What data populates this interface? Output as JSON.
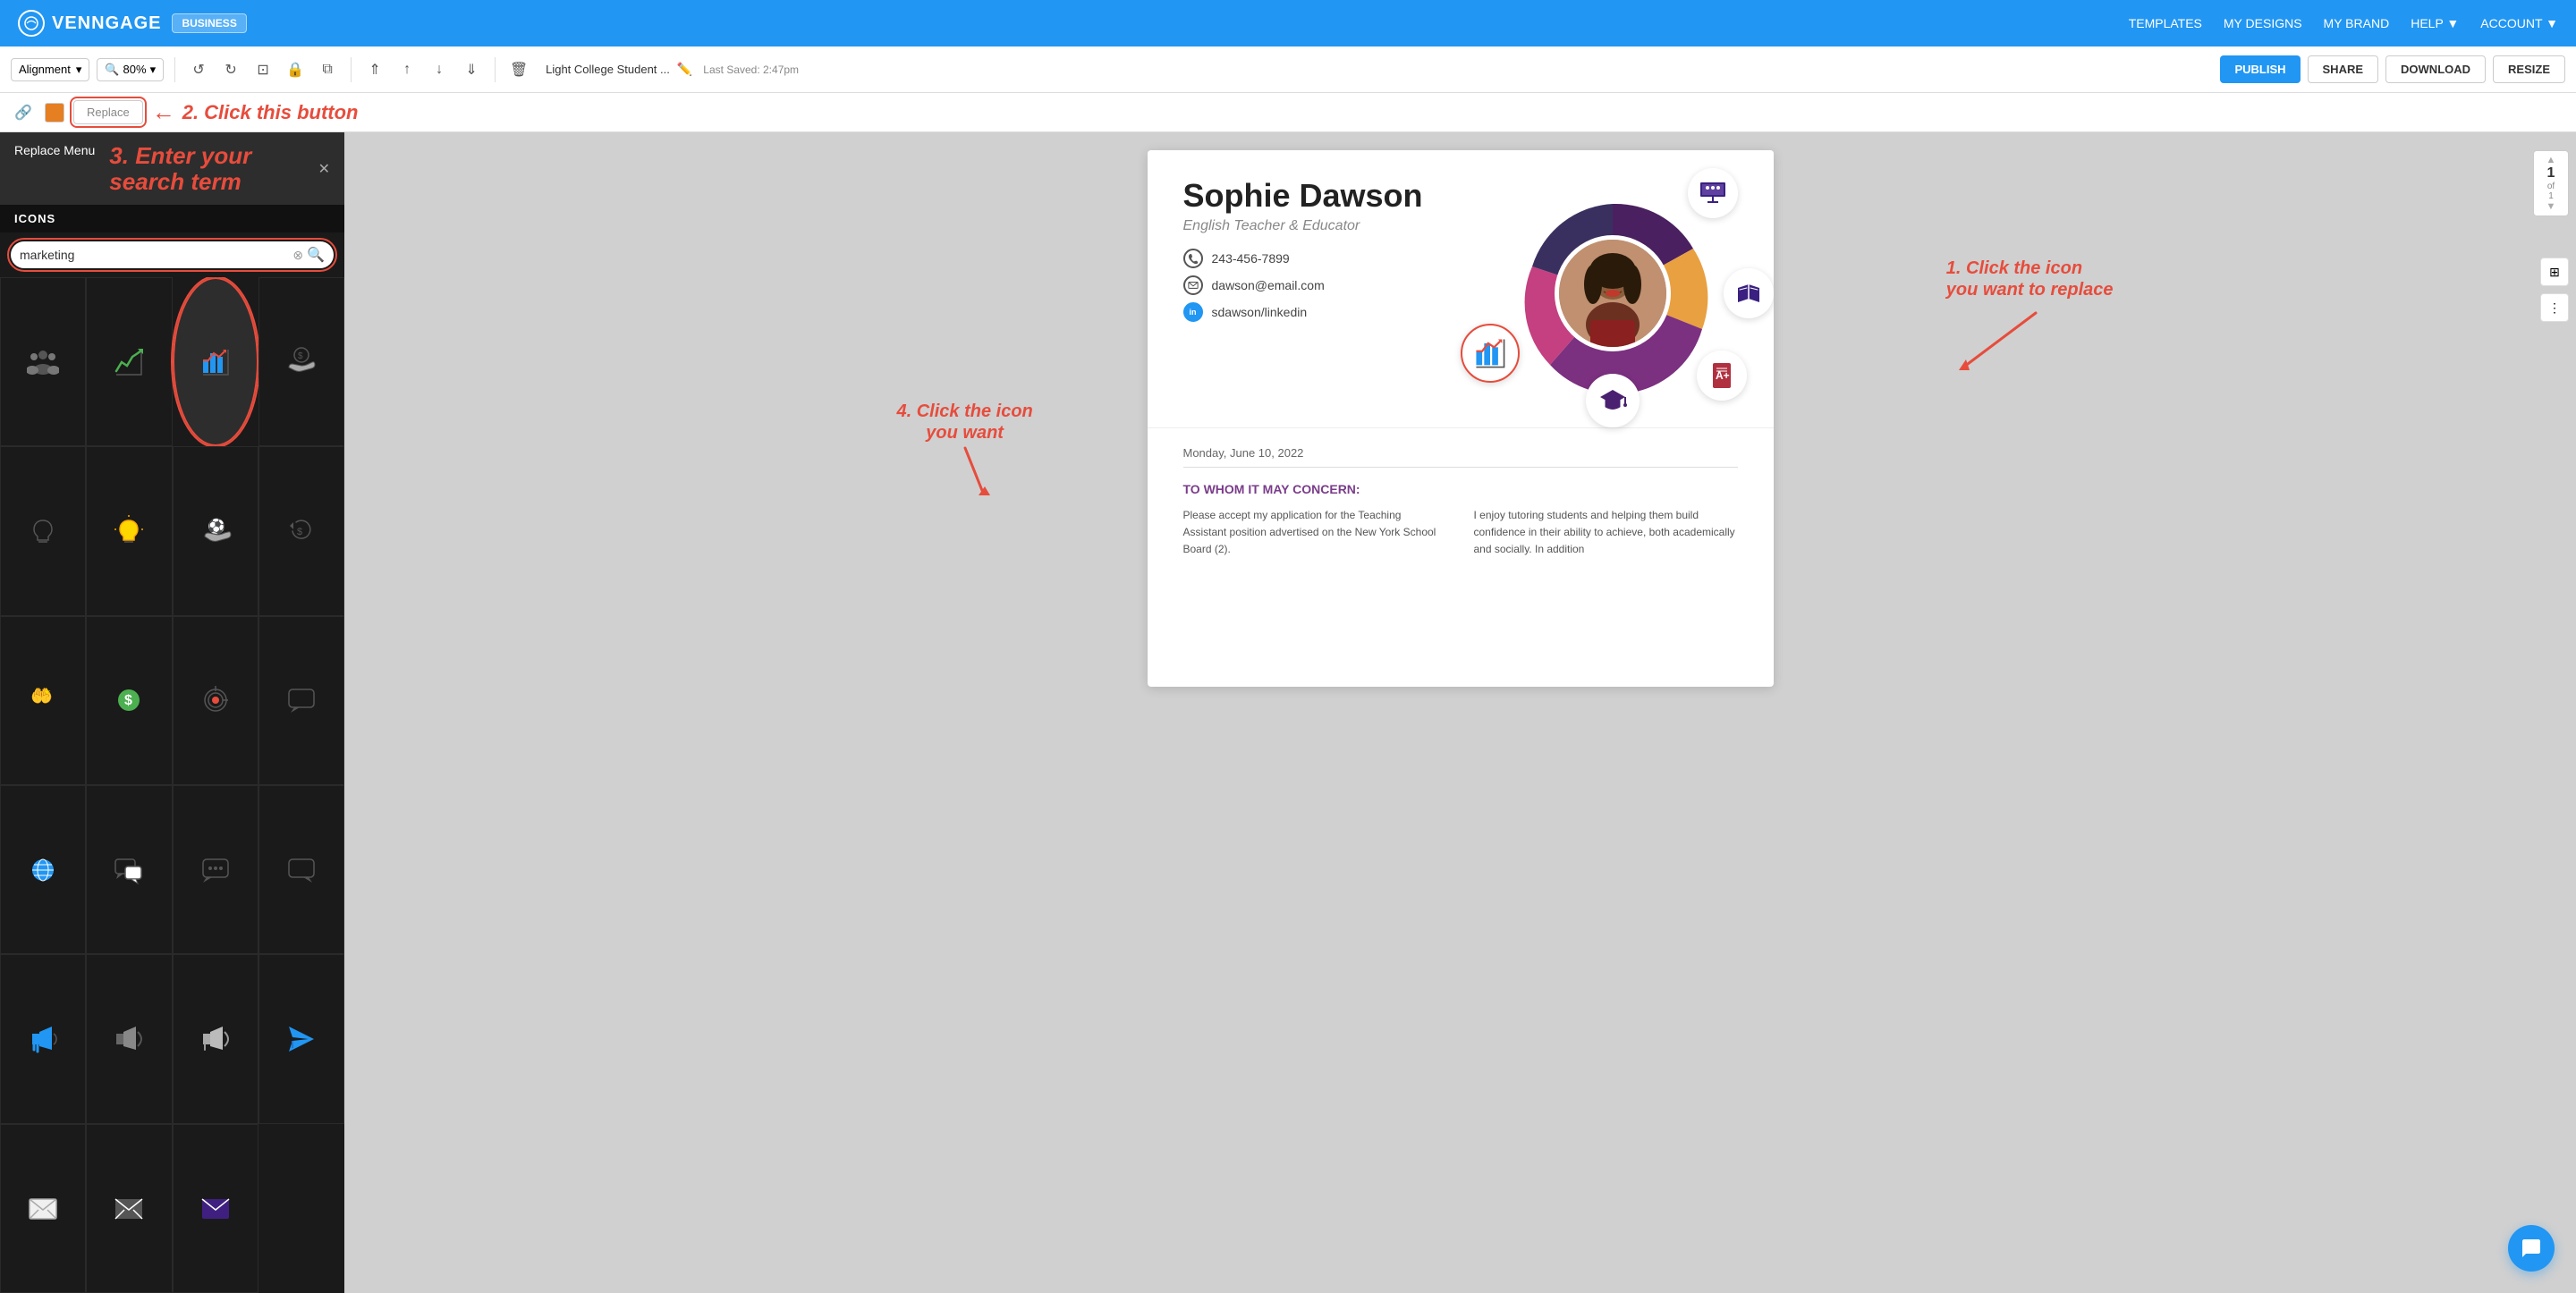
{
  "nav": {
    "logo": "VENNGAGE",
    "business_badge": "BUSINESS",
    "items": [
      "TEMPLATES",
      "MY DESIGNS",
      "MY BRAND",
      "HELP ▼",
      "ACCOUNT ▼"
    ]
  },
  "toolbar": {
    "alignment_label": "Alignment",
    "zoom_label": "80%",
    "title": "Light College Student ...",
    "saved_label": "Last Saved: 2:47pm",
    "publish_label": "PUBLISH",
    "share_label": "SHARE",
    "download_label": "DOWNLOAD",
    "resize_label": "RESIZE"
  },
  "icon_toolbar": {
    "replace_label": "Replace"
  },
  "panel": {
    "title": "Replace Menu",
    "section_label": "ICONS",
    "search_placeholder": "marketing",
    "search_value": "marketing"
  },
  "annotations": {
    "step1": "1. Click the icon\nyou want to replace",
    "step2": "2. Click this button",
    "step3_title": "Replace Menu",
    "step3_body": "3. Enter your\nsearch term",
    "step4": "4. Click the icon\nyou want"
  },
  "page_indicator": {
    "current": "1",
    "total": "1",
    "of_label": "of"
  },
  "design": {
    "name": "Sophie Dawson",
    "title": "English Teacher & Educator",
    "phone": "243-456-7899",
    "email": "dawson@email.com",
    "linkedin": "sdawson/linkedin",
    "date": "Monday, June 10, 2022",
    "concern": "TO WHOM IT MAY CONCERN:",
    "text_col1": "Please accept my application for the Teaching Assistant position advertised on the New York School Board (2).",
    "text_col2": "I enjoy tutoring students and helping them build confidence in their ability to achieve, both academically and socially. In addition"
  }
}
